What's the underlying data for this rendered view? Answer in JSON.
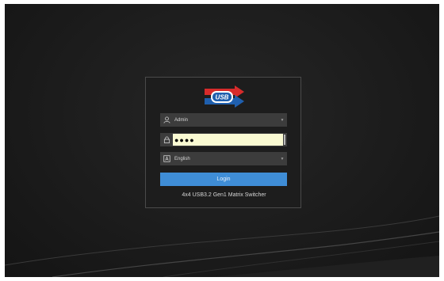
{
  "login": {
    "user": {
      "value": "Admin",
      "icon": "user-icon",
      "arrow": "▼"
    },
    "password": {
      "value": "●●●●",
      "icon": "lock-icon"
    },
    "language": {
      "value": "English",
      "icon": "language-icon",
      "arrow": "▼"
    },
    "login_label": "Login",
    "device_name": "4x4 USB3.2 Gen1 Matrix Switcher"
  },
  "logo": {
    "text": "USB",
    "colors": {
      "red": "#d62b2b",
      "blue": "#1f5fae"
    }
  },
  "colors": {
    "button": "#3f8dd6",
    "autofill": "#fafad2",
    "background": "#1c1c1c"
  }
}
